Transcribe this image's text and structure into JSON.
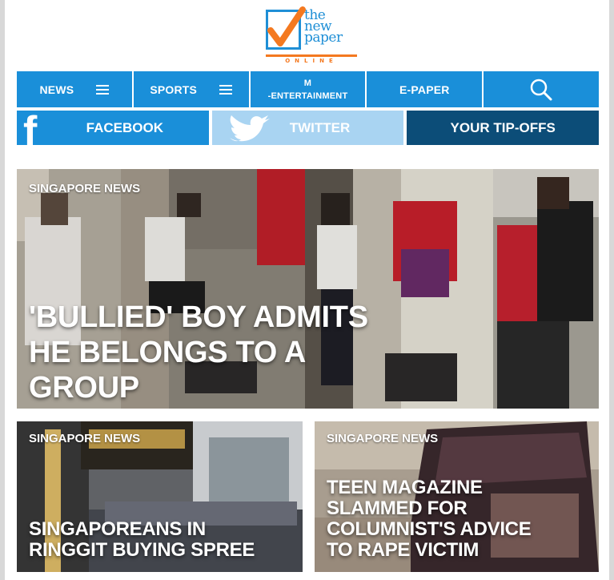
{
  "logo": {
    "line1": "the",
    "line2": "new",
    "line3": "paper",
    "online": "ONLINE"
  },
  "nav": {
    "news": "NEWS",
    "sports": "SPORTS",
    "ent_top": "M",
    "ent_bottom": "-ENTERTAINMENT",
    "epaper": "E-PAPER",
    "search_icon": "search-icon"
  },
  "social": {
    "facebook": "FACEBOOK",
    "twitter": "TWITTER",
    "tipoffs": "YOUR TIP-OFFS"
  },
  "colors": {
    "brand_blue": "#1a8fd9",
    "light_blue": "#a9d4f2",
    "dark_blue": "#0c4d78",
    "orange": "#f47920"
  },
  "hero": {
    "kicker": "SINGAPORE NEWS",
    "headline_1": "'BULLIED' BOY ADMITS",
    "headline_2": "HE BELONGS TO A",
    "headline_3": "GROUP"
  },
  "cards": [
    {
      "kicker": "SINGAPORE NEWS",
      "headline_1": "SINGAPOREANS IN",
      "headline_2": "RINGGIT BUYING SPREE"
    },
    {
      "kicker": "SINGAPORE NEWS",
      "headline_1": "TEEN MAGAZINE",
      "headline_2": "SLAMMED FOR",
      "headline_3": "COLUMNIST'S ADVICE",
      "headline_4": "TO RAPE VICTIM"
    }
  ]
}
